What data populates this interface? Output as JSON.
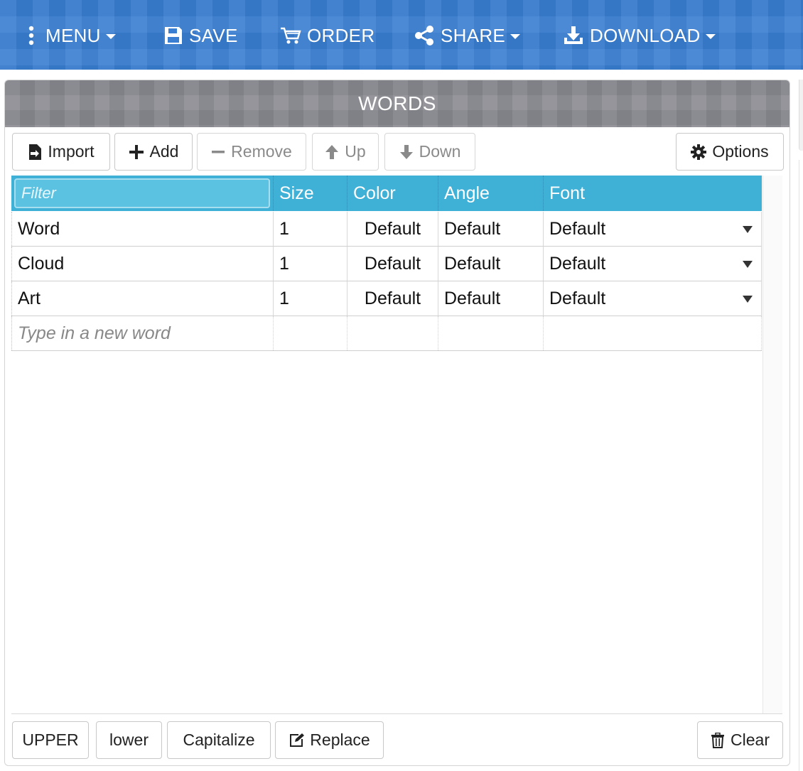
{
  "nav": {
    "menu": "MENU",
    "save": "SAVE",
    "order": "ORDER",
    "share": "SHARE",
    "download": "DOWNLOAD",
    "bar_color": "#3a7fd2"
  },
  "panel": {
    "title": "WORDS",
    "toolbar": {
      "import": "Import",
      "add": "Add",
      "remove": "Remove",
      "up": "Up",
      "down": "Down",
      "options": "Options"
    },
    "grid": {
      "filter_placeholder": "Filter",
      "columns": [
        "Size",
        "Color",
        "Angle",
        "Font"
      ],
      "rows": [
        {
          "word": "Word",
          "size": "1",
          "color": "Default",
          "angle": "Default",
          "font": "Default"
        },
        {
          "word": "Cloud",
          "size": "1",
          "color": "Default",
          "angle": "Default",
          "font": "Default"
        },
        {
          "word": "Art",
          "size": "1",
          "color": "Default",
          "angle": "Default",
          "font": "Default"
        }
      ],
      "new_word_placeholder": "Type in a new word",
      "header_color": "#3fb0d6"
    },
    "footer": {
      "upper": "UPPER",
      "lower": "lower",
      "capitalize": "Capitalize",
      "replace": "Replace",
      "clear": "Clear"
    }
  }
}
